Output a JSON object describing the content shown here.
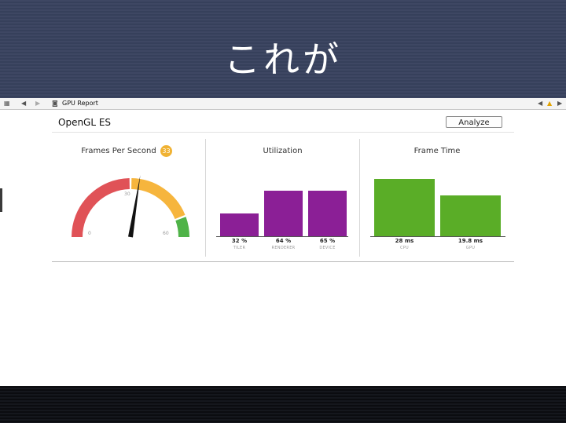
{
  "slide": {
    "title": "これが"
  },
  "toolbar": {
    "crumb": "GPU Report"
  },
  "report": {
    "section_title": "OpenGL ES",
    "analyze_label": "Analyze",
    "fps": {
      "title": "Frames Per Second",
      "value": "33",
      "gauge_min": "0",
      "gauge_mid": "30",
      "gauge_max": "60",
      "needle_value": 33,
      "colors": {
        "red": "#e05257",
        "yellow": "#f6b53d",
        "green": "#4fb348",
        "badge": "#f0b233"
      }
    },
    "utilization": {
      "title": "Utilization",
      "color": "#8b1f96",
      "bars": [
        {
          "value": "32 %",
          "caption": "TILER",
          "level": 32
        },
        {
          "value": "64 %",
          "caption": "RENDERER",
          "level": 64
        },
        {
          "value": "65 %",
          "caption": "DEVICE",
          "level": 65
        }
      ]
    },
    "frame_time": {
      "title": "Frame Time",
      "color": "#5aad27",
      "bars": [
        {
          "value": "28 ms",
          "caption": "CPU",
          "ms": 28
        },
        {
          "value": "19.8 ms",
          "caption": "GPU",
          "ms": 19.8
        }
      ]
    }
  }
}
